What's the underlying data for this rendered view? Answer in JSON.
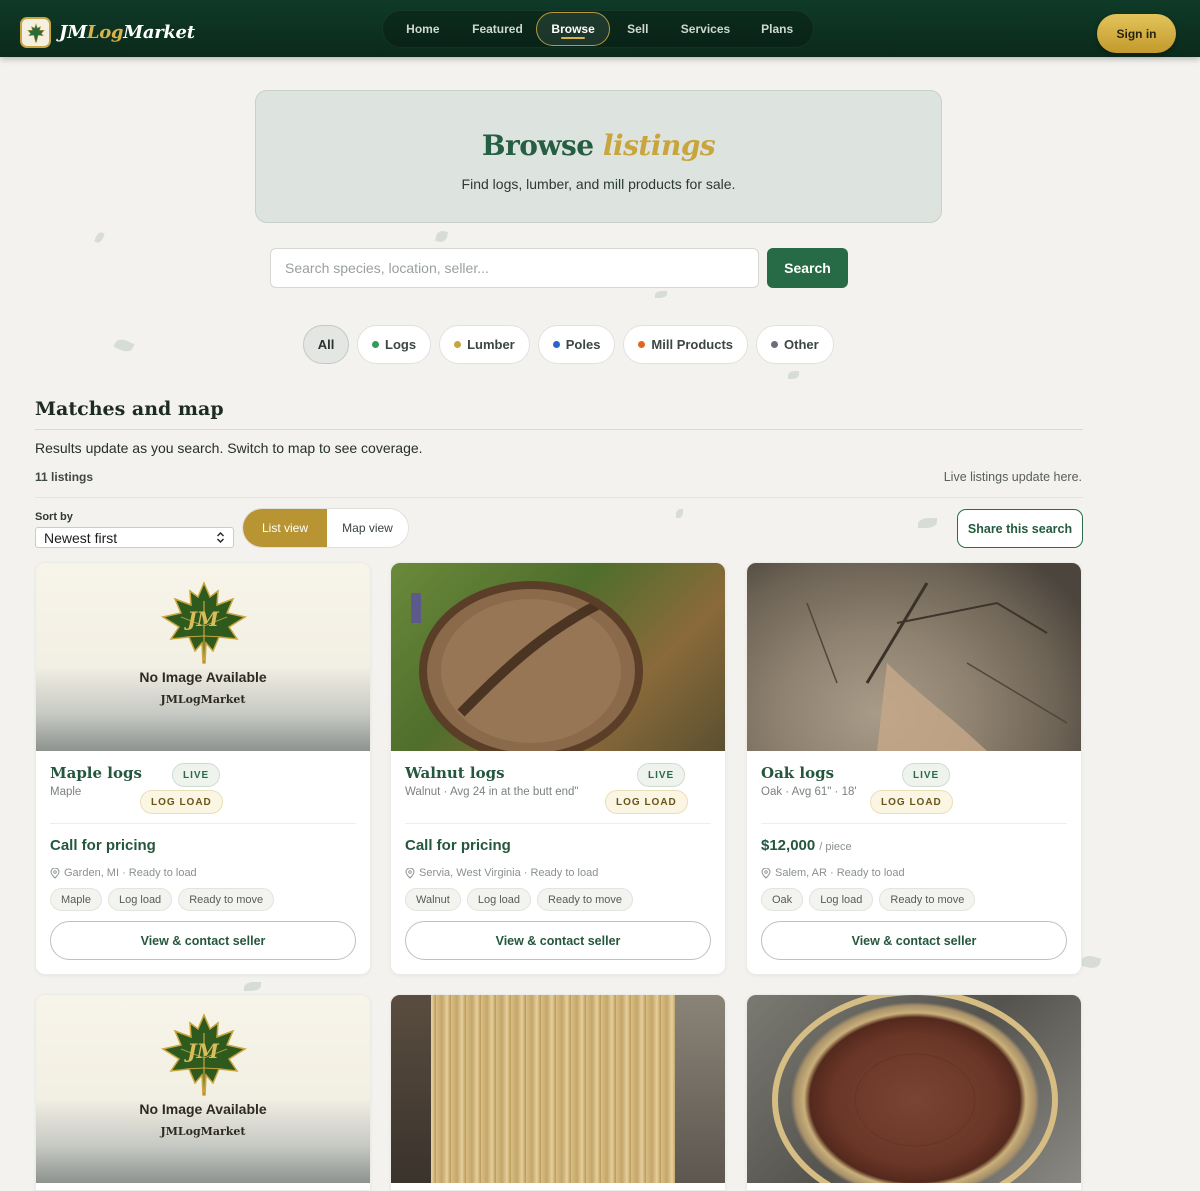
{
  "brand": {
    "prefix": "JM",
    "middle": "Log",
    "suffix": "Market"
  },
  "nav": {
    "items": [
      "Home",
      "Featured",
      "Browse",
      "Sell",
      "Services",
      "Plans"
    ],
    "active": "Browse"
  },
  "signin_label": "Sign in",
  "hero": {
    "title": "Browse",
    "title_accent": "listings",
    "subtitle": "Find logs, lumber, and mill products for sale."
  },
  "search": {
    "placeholder": "Search species, location, seller...",
    "button": "Search"
  },
  "filters": {
    "all": "All",
    "items": [
      {
        "label": "Logs",
        "color": "#2f9e5b"
      },
      {
        "label": "Lumber",
        "color": "#c9a53d"
      },
      {
        "label": "Poles",
        "color": "#2b64c6"
      },
      {
        "label": "Mill Products",
        "color": "#e0671f"
      },
      {
        "label": "Other",
        "color": "#6b6f7a"
      }
    ]
  },
  "section": {
    "title": "Matches and map",
    "description": "Results update as you search. Switch to map to see coverage.",
    "count": "11 listings",
    "live_note": "Live listings update here."
  },
  "controls": {
    "sort_label": "Sort by",
    "sort_value": "Newest first",
    "list_view": "List view",
    "map_view": "Map view",
    "share": "Share this search"
  },
  "placeholder_image": {
    "text": "No Image Available",
    "brand": "JMLogMarket",
    "mono": "JM"
  },
  "listings": [
    {
      "title": "Maple logs",
      "subtitle": "Maple",
      "live": "LIVE",
      "badge": "LOG LOAD",
      "price": "Call for pricing",
      "unit": "",
      "location": "Garden, MI · Ready to load",
      "tags": [
        "Maple",
        "Log load",
        "Ready to move"
      ],
      "cta": "View & contact seller"
    },
    {
      "title": "Walnut logs",
      "subtitle": "Walnut · Avg 24 in at the butt end\"",
      "live": "LIVE",
      "badge": "LOG LOAD",
      "price": "Call for pricing",
      "unit": "",
      "location": "Servia, West Virginia · Ready to load",
      "tags": [
        "Walnut",
        "Log load",
        "Ready to move"
      ],
      "cta": "View & contact seller"
    },
    {
      "title": "Oak logs",
      "subtitle": "Oak · Avg 61\" · 18'",
      "live": "LIVE",
      "badge": "LOG LOAD",
      "price": "$12,000",
      "unit": "/ piece",
      "location": "Salem, AR · Ready to load",
      "tags": [
        "Oak",
        "Log load",
        "Ready to move"
      ],
      "cta": "View & contact seller"
    }
  ]
}
